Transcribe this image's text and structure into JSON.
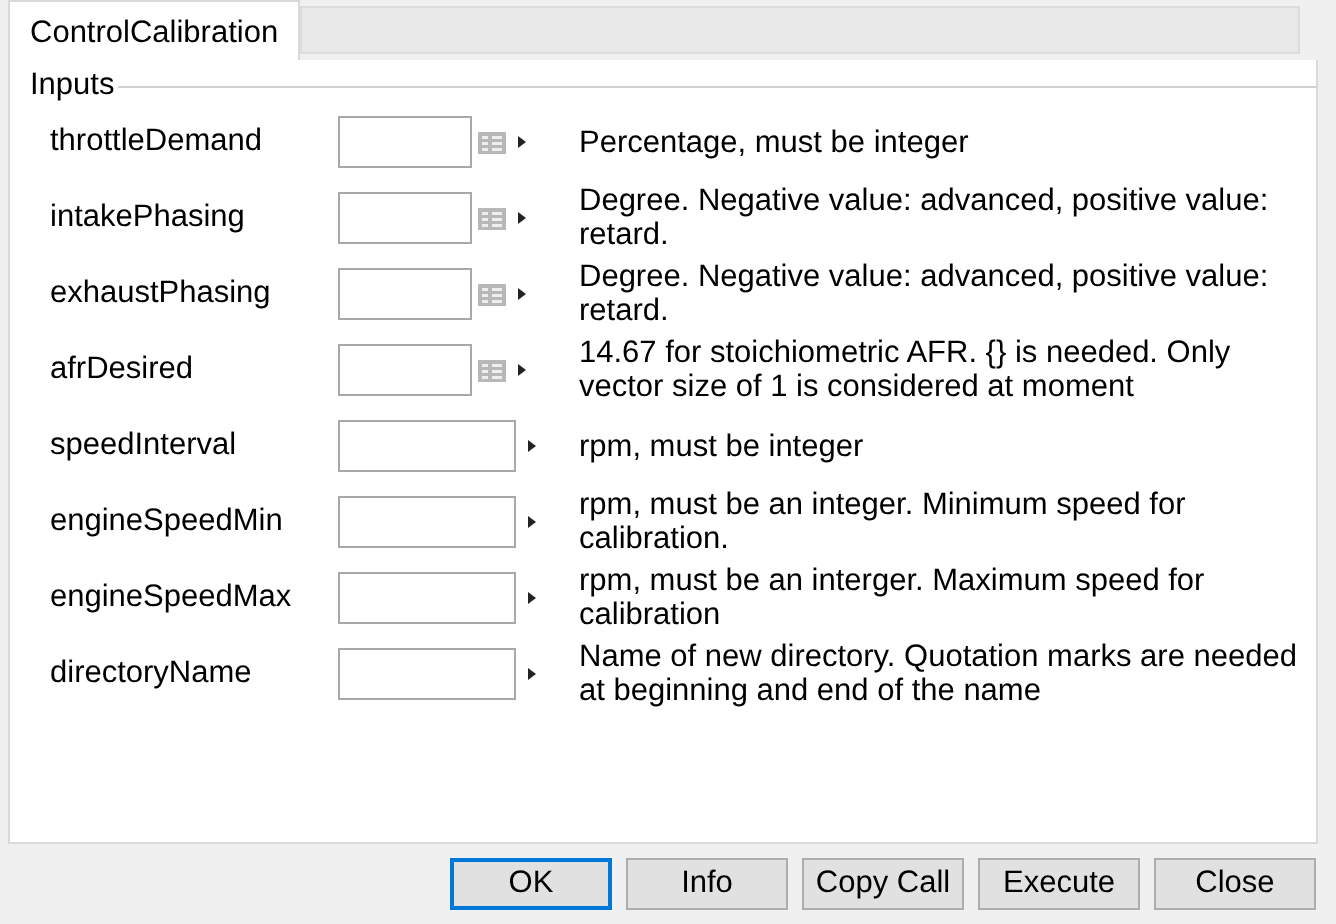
{
  "tabs": [
    {
      "label": "ControlCalibration",
      "selected": true
    }
  ],
  "group": {
    "title": "Inputs"
  },
  "inputs": [
    {
      "name": "throttleDemand",
      "kind": "matrix",
      "description": "Percentage, must be integer"
    },
    {
      "name": "intakePhasing",
      "kind": "matrix",
      "description": "Degree. Negative value: advanced, positive value: retard."
    },
    {
      "name": "exhaustPhasing",
      "kind": "matrix",
      "description": "Degree. Negative value: advanced, positive value: retard."
    },
    {
      "name": "afrDesired",
      "kind": "matrix",
      "description": "14.67 for stoichiometric AFR. {} is needed. Only vector size of 1 is considered at moment"
    },
    {
      "name": "speedInterval",
      "kind": "scalar",
      "description": "rpm, must be integer"
    },
    {
      "name": "engineSpeedMin",
      "kind": "scalar",
      "description": "rpm, must be an integer. Minimum speed for calibration."
    },
    {
      "name": "engineSpeedMax",
      "kind": "scalar",
      "description": "rpm, must be an interger. Maximum speed for calibration"
    },
    {
      "name": "directoryName",
      "kind": "scalar",
      "description": "Name of new directory. Quotation marks are needed at beginning and end of the name"
    }
  ],
  "buttons": [
    {
      "label": "OK",
      "default": true
    },
    {
      "label": "Info",
      "default": false
    },
    {
      "label": "Copy Call",
      "default": false
    },
    {
      "label": "Execute",
      "default": false
    },
    {
      "label": "Close",
      "default": false
    }
  ]
}
